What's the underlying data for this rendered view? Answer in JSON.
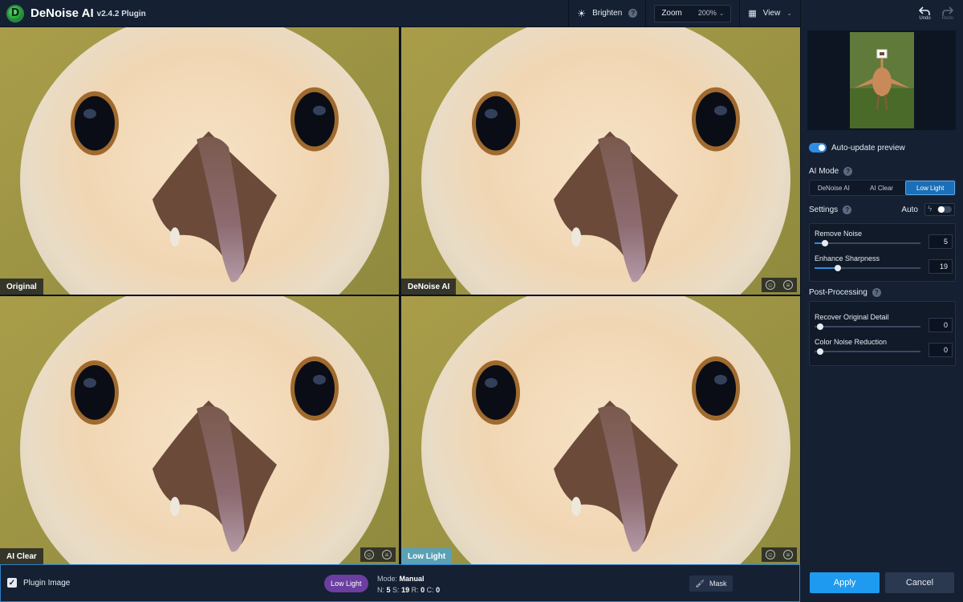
{
  "app": {
    "title": "DeNoise AI",
    "version": "v2.4.2 Plugin",
    "logo_letter": "D"
  },
  "toolbar": {
    "brighten_label": "Brighten",
    "help_glyph": "?",
    "zoom_label": "Zoom",
    "zoom_value": "200%",
    "view_label": "View",
    "undo_label": "Undo",
    "redo_label": "Redo"
  },
  "panels": {
    "original_label": "Original",
    "denoise_label": "DeNoise AI",
    "aiclear_label": "AI Clear",
    "lowlight_label": "Low Light"
  },
  "sidebar": {
    "auto_update_label": "Auto-update preview",
    "ai_mode_title": "AI Mode",
    "mode_tabs": [
      "DeNoise AI",
      "AI Clear",
      "Low Light"
    ],
    "active_mode": "Low Light",
    "settings_title": "Settings",
    "auto_label": "Auto",
    "remove_noise_label": "Remove Noise",
    "remove_noise_value": "5",
    "enhance_sharpness_label": "Enhance Sharpness",
    "enhance_sharpness_value": "19",
    "post_processing_title": "Post-Processing",
    "recover_detail_label": "Recover Original Detail",
    "recover_detail_value": "0",
    "color_noise_label": "Color Noise Reduction",
    "color_noise_value": "0"
  },
  "bottom": {
    "plugin_image_label": "Plugin Image",
    "mode_pill": "Low Light",
    "mode_caption": "Mode:",
    "mode_value": "Manual",
    "n_label": "N:",
    "n_value": "5",
    "s_label": "S:",
    "s_value": "19",
    "r_label": "R:",
    "r_value": "0",
    "c_label": "C:",
    "c_value": "0",
    "mask_label": "Mask",
    "apply_label": "Apply",
    "cancel_label": "Cancel"
  },
  "colors": {
    "accent": "#1e9bf0",
    "active_tab": "#1a6fb8",
    "mode_pill": "#6a3fa0",
    "background": "#152033"
  }
}
